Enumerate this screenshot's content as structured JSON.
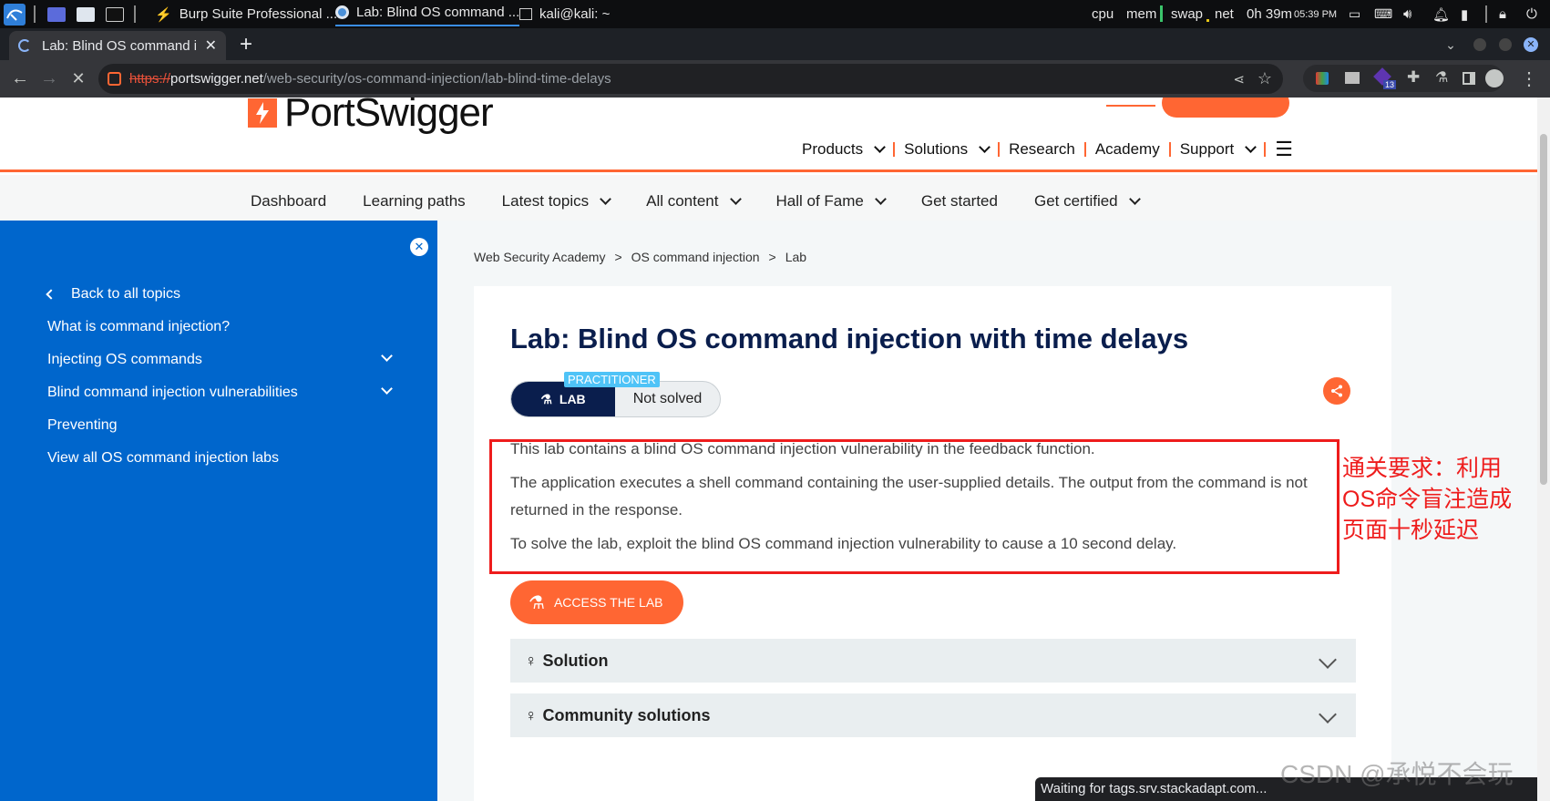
{
  "taskbar": {
    "windows": [
      "Burp Suite Professional ...",
      "Lab: Blind OS command ...",
      "kali@kali: ~"
    ],
    "meters": [
      "cpu",
      "mem",
      "swap",
      "net"
    ],
    "uptime": "0h 39m",
    "clock": "05:39 PM"
  },
  "browser": {
    "tab_title": "Lab: Blind OS command in",
    "url_scheme": "https://",
    "url_host": "portswigger.net",
    "url_path": "/web-security/os-command-injection/lab-blind-time-delays",
    "extension_badge": "13",
    "status_text": "Waiting for tags.srv.stackadapt.com..."
  },
  "header": {
    "logo_text": "PortSwigger",
    "nav": [
      "Products",
      "Solutions",
      "Research",
      "Academy",
      "Support"
    ]
  },
  "subnav": [
    "Dashboard",
    "Learning paths",
    "Latest topics",
    "All content",
    "Hall of Fame",
    "Get started",
    "Get certified"
  ],
  "sidebar": {
    "back": "Back to all topics",
    "items": [
      "What is command injection?",
      "Injecting OS commands",
      "Blind command injection vulnerabilities",
      "Preventing",
      "View all OS command injection labs"
    ]
  },
  "breadcrumb": [
    "Web Security Academy",
    ">",
    "OS command injection",
    ">",
    "Lab"
  ],
  "lab": {
    "title": "Lab: Blind OS command injection with time delays",
    "level": "PRACTITIONER",
    "type_label": "LAB",
    "status": "Not solved",
    "paragraphs": [
      "This lab contains a blind OS command injection vulnerability in the feedback function.",
      "The application executes a shell command containing the user-supplied details. The output from the command is not returned in the response.",
      "To solve the lab, exploit the blind OS command injection vulnerability to cause a 10 second delay."
    ],
    "access_button": "ACCESS THE LAB",
    "accordions": [
      "Solution",
      "Community solutions"
    ]
  },
  "annotation": "通关要求：利用OS命令盲注造成页面十秒延迟",
  "watermark": "CSDN @承悦不会玩",
  "colors": {
    "brand_orange": "#ff6633",
    "sidebar_blue": "#0066cc",
    "title_navy": "#0a1e4d",
    "annotation_red": "#ee1c1c"
  }
}
